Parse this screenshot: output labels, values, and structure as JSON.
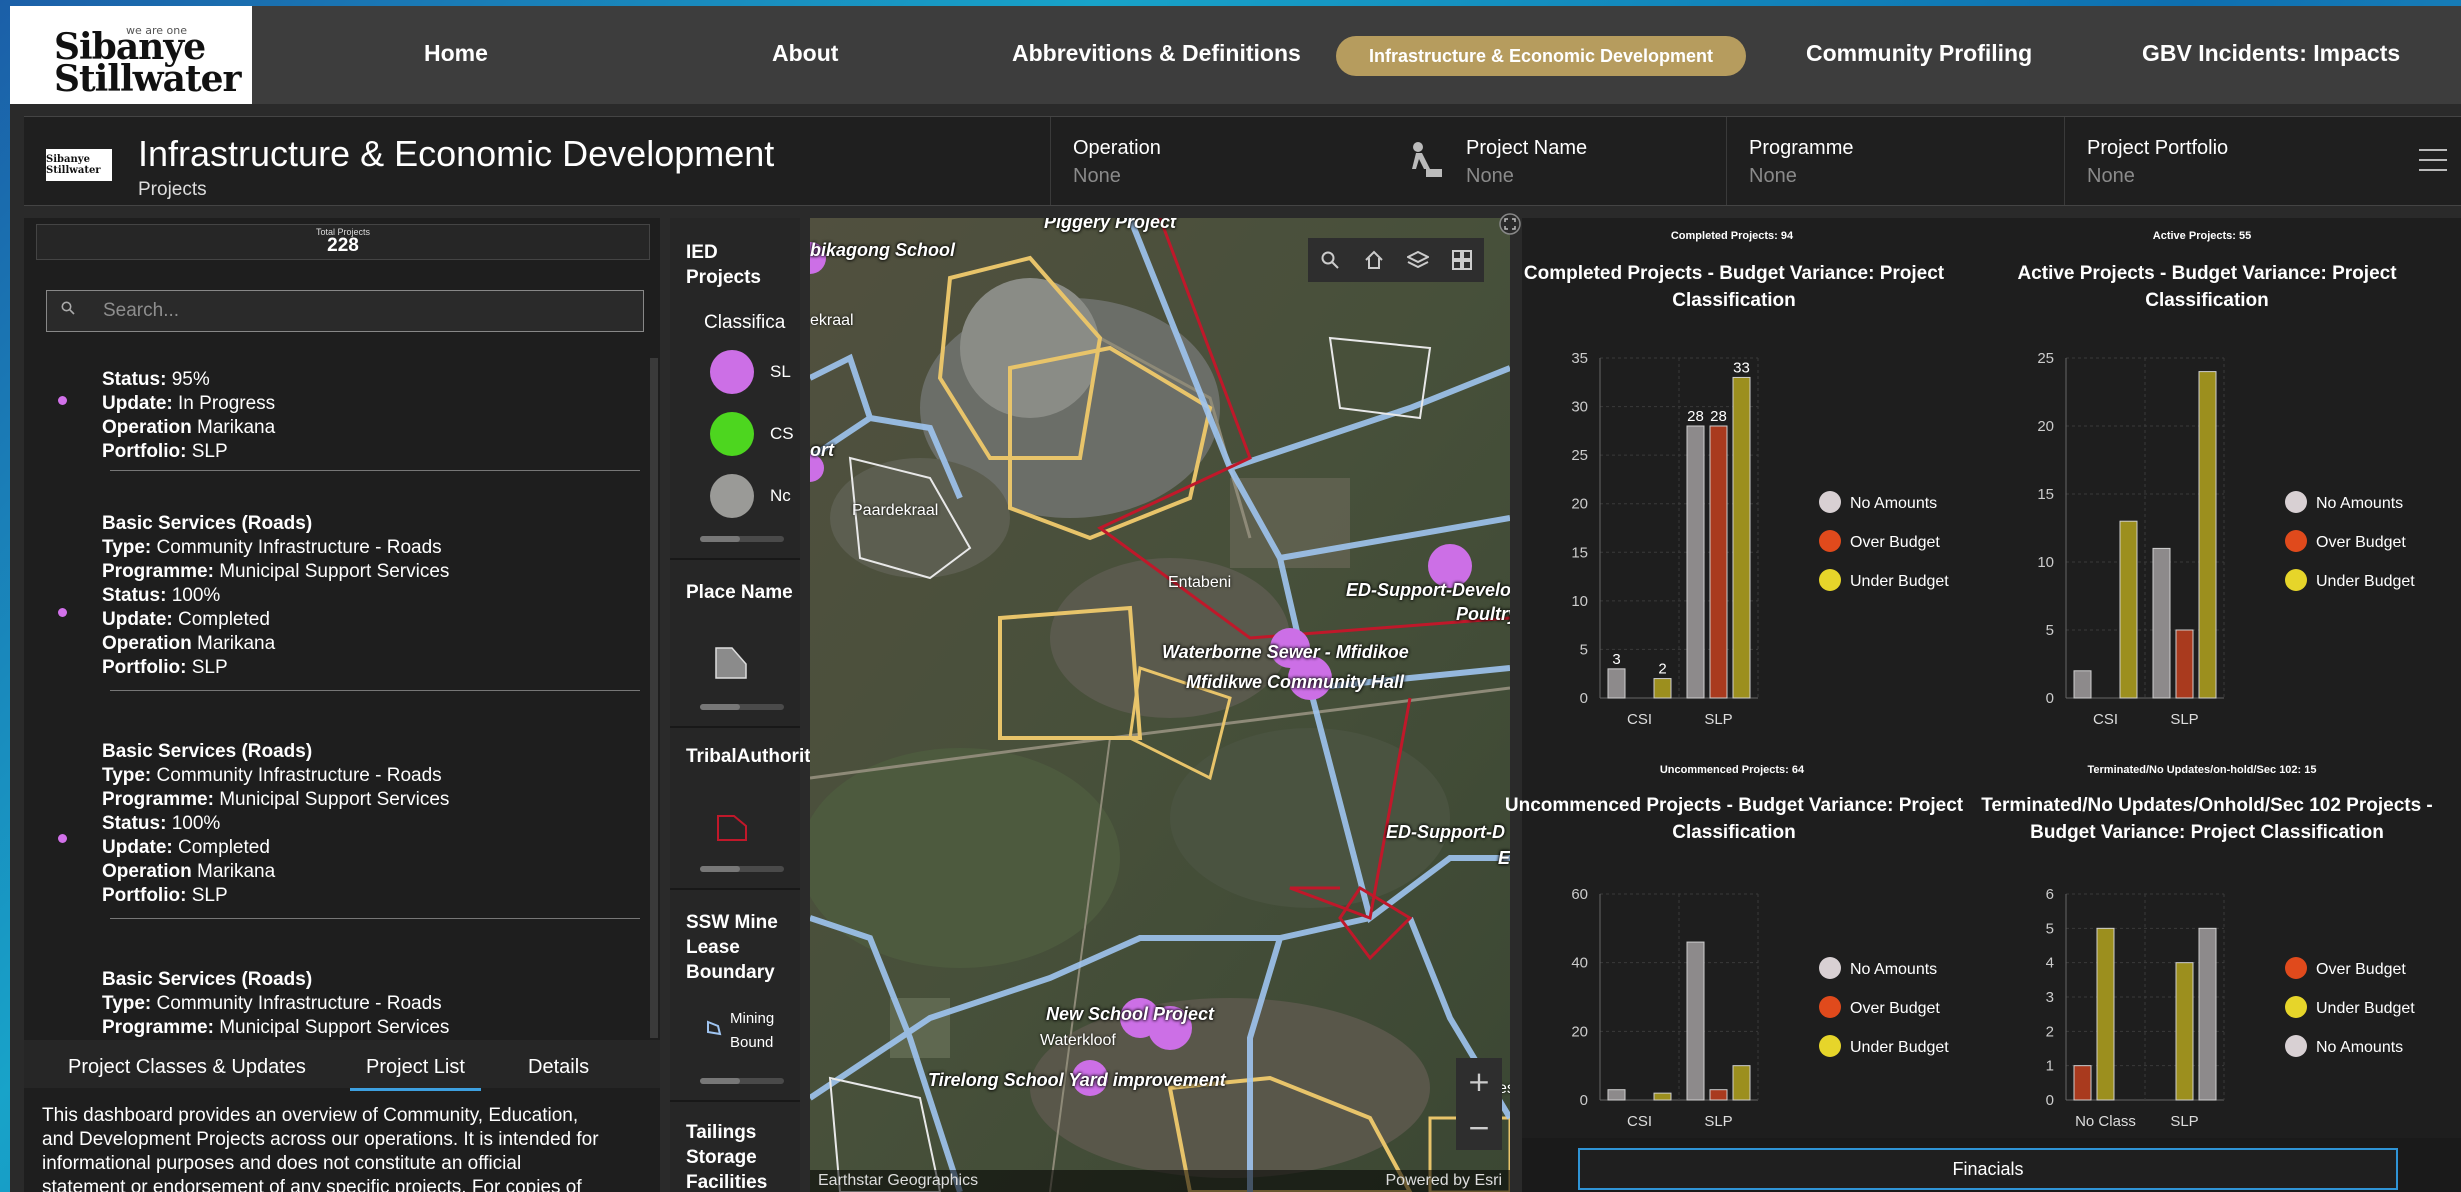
{
  "nav": {
    "brand_small": "we are one",
    "brand_line1": "Sibanye",
    "brand_line2": "Stillwater",
    "items": [
      "Home",
      "About",
      "Abbrevitions & Definitions",
      "Infrastructure & Economic Development",
      "Community Profiling",
      "GBV Incidents: Impacts"
    ],
    "active": "Infrastructure & Economic Development"
  },
  "header": {
    "logo_text": "Sibanye Stillwater",
    "title": "Infrastructure & Economic Development",
    "subtitle": "Projects",
    "filters": [
      {
        "label": "Operation",
        "value": "None"
      },
      {
        "label": "Project Name",
        "value": "None"
      },
      {
        "label": "Programme",
        "value": "None"
      },
      {
        "label": "Project Portfolio",
        "value": "None"
      }
    ]
  },
  "left": {
    "total_label": "Total Projects",
    "total_value": "228",
    "search_placeholder": "Search...",
    "record0": {
      "status_label": "Status:",
      "status": "95%",
      "update_label": "Update:",
      "update": "In Progress",
      "operation_label": "Operation",
      "operation": "Marikana",
      "portfolio_label": "Portfolio:",
      "portfolio": "SLP"
    },
    "records": [
      {
        "name": "Basic Services (Roads)",
        "type_label": "Type:",
        "type": "Community Infrastructure - Roads",
        "programme_label": "Programme:",
        "programme": "Municipal Support Services",
        "status_label": "Status:",
        "status": "100%",
        "update_label": "Update:",
        "update": "Completed",
        "operation_label": "Operation",
        "operation": "Marikana",
        "portfolio_label": "Portfolio:",
        "portfolio": "SLP"
      },
      {
        "name": "Basic Services (Roads)",
        "type_label": "Type:",
        "type": "Community Infrastructure - Roads",
        "programme_label": "Programme:",
        "programme": "Municipal Support Services",
        "status_label": "Status:",
        "status": "100%",
        "update_label": "Update:",
        "update": "Completed",
        "operation_label": "Operation",
        "operation": "Marikana",
        "portfolio_label": "Portfolio:",
        "portfolio": "SLP"
      },
      {
        "name": "Basic Services (Roads)",
        "type_label": "Type:",
        "type": "Community Infrastructure - Roads",
        "programme_label": "Programme:",
        "programme": "Municipal Support Services"
      }
    ],
    "tabs": [
      "Project Classes & Updates",
      "Project List",
      "Details"
    ],
    "active_tab": "Project List",
    "intro_lines": [
      "This dashboard provides an overview of Community, Education,",
      "and Development Projects across our operations. It is intended for",
      "informational purposes and does not constitute an official",
      "statement or endorsement of any specific projects. For copies of"
    ]
  },
  "legend": {
    "ied_title": "IED Projects",
    "classification": "Classifica",
    "classes": [
      {
        "label": "SL",
        "color": "#cc6fe6"
      },
      {
        "label": "CS",
        "color": "#4dd61f"
      },
      {
        "label": "Nc",
        "color": "#9a9a97"
      }
    ],
    "place_title": "Place Name",
    "tribal_title": "TribalAuthority",
    "mine_title": "SSW Mine Lease Boundary",
    "mine_item_1": "Mining",
    "mine_item_2": "Bound",
    "tailings_title": "Tailings Storage Facilities"
  },
  "map": {
    "labels": [
      "Piggery Project",
      "bikagong School",
      "ekraal",
      "ort",
      "Paardekraal",
      "Entabeni",
      "ED-Support-Develo",
      "Poultry",
      "Waterborne Sewer - Mfidikoe",
      "Mfidikwe Community Hall",
      "ED-Support-D",
      "E",
      "New School Project",
      "Waterkloof",
      "Tirelong School Yard improvement",
      "tles"
    ],
    "attribution_left": "Earthstar Geographics",
    "attribution_right": "Powered by Esri",
    "zoom_in": "+",
    "zoom_out": "−"
  },
  "colors": {
    "under_budget": "#e6d52a",
    "over_budget": "#e04a1c",
    "no_amounts": "#d8d0d3",
    "bar_gray": "#8d8a8b",
    "bar_red": "#a93a1e",
    "bar_olive": "#9c8f1e"
  },
  "chart_data": [
    {
      "type": "bar",
      "mini_title": "Completed Projects: 94",
      "title": "Completed Projects - Budget Variance: Project Classification",
      "categories": [
        "CSI",
        "SLP"
      ],
      "series": [
        {
          "name": "No Amounts",
          "values": [
            3,
            28
          ]
        },
        {
          "name": "Over Budget",
          "values": [
            0,
            28
          ]
        },
        {
          "name": "Under Budget",
          "values": [
            2,
            33
          ]
        }
      ],
      "data_labels": [
        [
          "3",
          null,
          "2"
        ],
        [
          "28",
          "28",
          "33"
        ]
      ],
      "ylim": [
        0,
        35
      ],
      "yticks": [
        0,
        5,
        10,
        15,
        20,
        25,
        30,
        35
      ],
      "legend": [
        "No Amounts",
        "Over Budget",
        "Under Budget"
      ],
      "legend_position": "right"
    },
    {
      "type": "bar",
      "mini_title": "Active Projects: 55",
      "title": "Active Projects - Budget Variance: Project Classification",
      "categories": [
        "CSI",
        "SLP"
      ],
      "series": [
        {
          "name": "No Amounts",
          "values": [
            2,
            11
          ]
        },
        {
          "name": "Over Budget",
          "values": [
            0,
            5
          ]
        },
        {
          "name": "Under Budget",
          "values": [
            13,
            24
          ]
        }
      ],
      "ylim": [
        0,
        25
      ],
      "yticks": [
        0,
        5,
        10,
        15,
        20,
        25
      ],
      "legend": [
        "No Amounts",
        "Over Budget",
        "Under Budget"
      ],
      "legend_position": "right"
    },
    {
      "type": "bar",
      "mini_title": "Uncommenced Projects: 64",
      "title": "Uncommenced Projects - Budget Variance: Project Classification",
      "categories": [
        "CSI",
        "SLP"
      ],
      "series": [
        {
          "name": "No Amounts",
          "values": [
            3,
            46
          ]
        },
        {
          "name": "Over Budget",
          "values": [
            0,
            3
          ]
        },
        {
          "name": "Under Budget",
          "values": [
            2,
            10
          ]
        }
      ],
      "ylim": [
        0,
        60
      ],
      "yticks": [
        0,
        20,
        40,
        60
      ],
      "legend": [
        "No Amounts",
        "Over Budget",
        "Under Budget"
      ],
      "legend_position": "right"
    },
    {
      "type": "bar",
      "mini_title": "Terminated/No Updates/on-hold/Sec 102: 15",
      "title": "Terminated/No Updates/Onhold/Sec 102 Projects - Budget Variance: Project Classification",
      "categories": [
        "No Class",
        "SLP"
      ],
      "series": [
        {
          "name": "Over Budget",
          "values": [
            1,
            0
          ]
        },
        {
          "name": "Under Budget",
          "values": [
            5,
            4
          ]
        },
        {
          "name": "No Amounts",
          "values": [
            0,
            5
          ]
        }
      ],
      "ylim": [
        0,
        6
      ],
      "yticks": [
        0,
        1,
        2,
        3,
        4,
        5,
        6
      ],
      "legend": [
        "Over Budget",
        "Under Budget",
        "No Amounts"
      ],
      "legend_position": "right"
    }
  ],
  "footer": {
    "financials_label": "Finacials"
  }
}
